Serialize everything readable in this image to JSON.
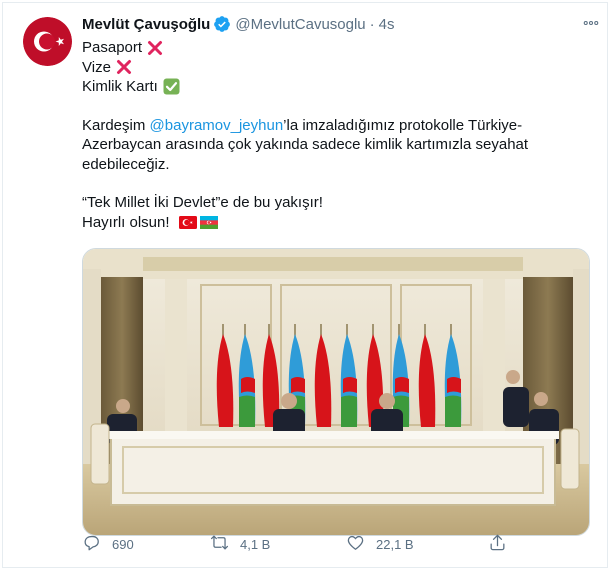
{
  "tweet": {
    "display_name": "Mevlüt Çavuşoğlu",
    "handle": "@MevlutCavusoglu",
    "dot": "·",
    "time": "4s",
    "lines": {
      "pasaport": "Pasaport",
      "vize": "Vize",
      "kimlik": "Kimlik Kartı"
    },
    "para1": {
      "prefix": "Kardeşim ",
      "mention": "@bayramov_jeyhun",
      "suffix": "’la imzaladığımız protokolle Türkiye-Azerbaycan arasında çok yakında sadece kimlik kartımızla seyahat edebileceğiz."
    },
    "para2": {
      "line1": "“Tek Millet İki Devlet”e de bu yakışır!",
      "line2": "Hayırlı olsun!"
    }
  },
  "actions": {
    "reply_count": "690",
    "retweet_count": "4,1 B",
    "like_count": "22,1 B"
  },
  "colors": {
    "link": "#1b95e0",
    "verified": "#1da1f2",
    "muted": "#5b7083",
    "turkey_red": "#e30a17"
  },
  "icons": [
    "verified-badge-icon",
    "more-icon",
    "cross-mark-icon",
    "check-mark-icon",
    "turkey-flag-icon",
    "azerbaijan-flag-icon",
    "reply-icon",
    "retweet-icon",
    "like-icon",
    "share-icon"
  ]
}
